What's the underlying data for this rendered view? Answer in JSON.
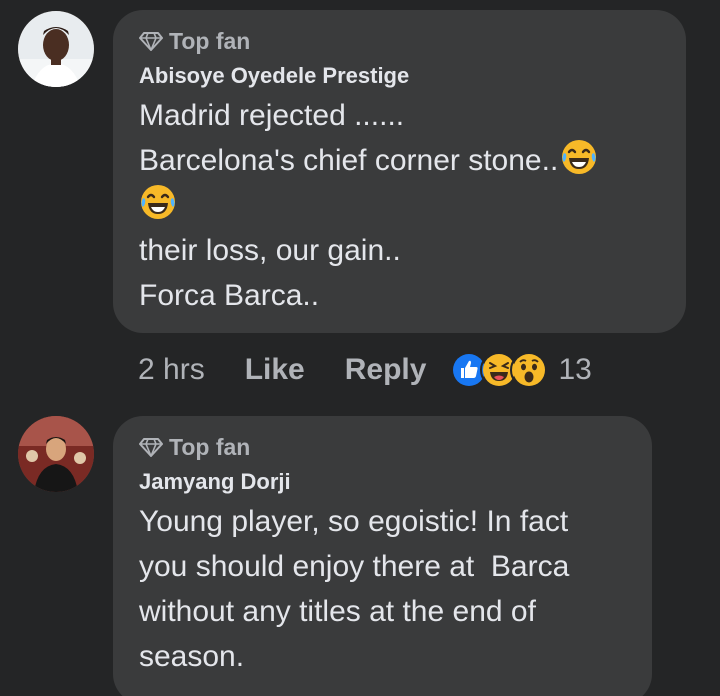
{
  "comments": [
    {
      "badge": "Top fan",
      "author": "Abisoye Oyedele Prestige",
      "lines": [
        "Madrid rejected ......",
        "Barcelona's chief corner stone..",
        "",
        "their loss, our gain..",
        "Forca Barca.."
      ],
      "time": "2 hrs",
      "like_label": "Like",
      "reply_label": "Reply",
      "reaction_count": "13",
      "reactions": [
        "like-icon",
        "laughing-squint-icon",
        "wow-icon"
      ],
      "emojis": [
        "tears-of-joy-icon",
        "tears-of-joy-icon"
      ]
    },
    {
      "badge": "Top fan",
      "author": "Jamyang Dorji",
      "lines": [
        "Young player, so egoistic! In fact",
        "you should enjoy there at  Barca",
        "without any titles at the end of",
        "season."
      ]
    }
  ],
  "colors": {
    "background": "#242526",
    "bubble": "#3a3b3c",
    "text": "#e4e6eb",
    "secondary": "#b0b3b8",
    "like_blue": "#1877f2",
    "emoji_yellow": "#f7b928"
  }
}
